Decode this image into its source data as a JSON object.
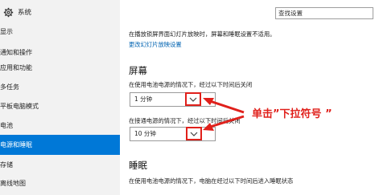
{
  "window": {
    "title": "系统"
  },
  "search": {
    "placeholder": "查找设置"
  },
  "sidebar": {
    "items": [
      {
        "label": "显示"
      },
      {
        "label": "通知和操作"
      },
      {
        "label": "应用和功能"
      },
      {
        "label": "多任务"
      },
      {
        "label": "平板电脑模式"
      },
      {
        "label": "电池"
      },
      {
        "label": "电源和睡眠",
        "selected": true
      },
      {
        "label": "存储"
      },
      {
        "label": "离线地图"
      }
    ]
  },
  "main": {
    "description": "在播放锁屏界面幻灯片放映时，屏幕和睡眠设置不适用。",
    "link": "更改幻灯片放映设置",
    "screen": {
      "title": "屏幕",
      "battery_label": "在使用电池电源的情况下，经过以下时间后关闭",
      "battery_value": "1 分钟",
      "plugged_label": "在接通电源的情况下，经过以下时间后关闭",
      "plugged_value": "10 分钟"
    },
    "sleep": {
      "title": "睡眠",
      "battery_label": "在使用电池电源的情况下，电脑在经过以下时间后进入睡眠状态"
    }
  },
  "annotation": {
    "text": "单击”下拉符号 ”"
  },
  "colors": {
    "accent": "#0078d7",
    "annotation_red": "#e0201b"
  },
  "icons": {
    "app": "gear-icon",
    "dropdown": "chevron-down-icon"
  }
}
